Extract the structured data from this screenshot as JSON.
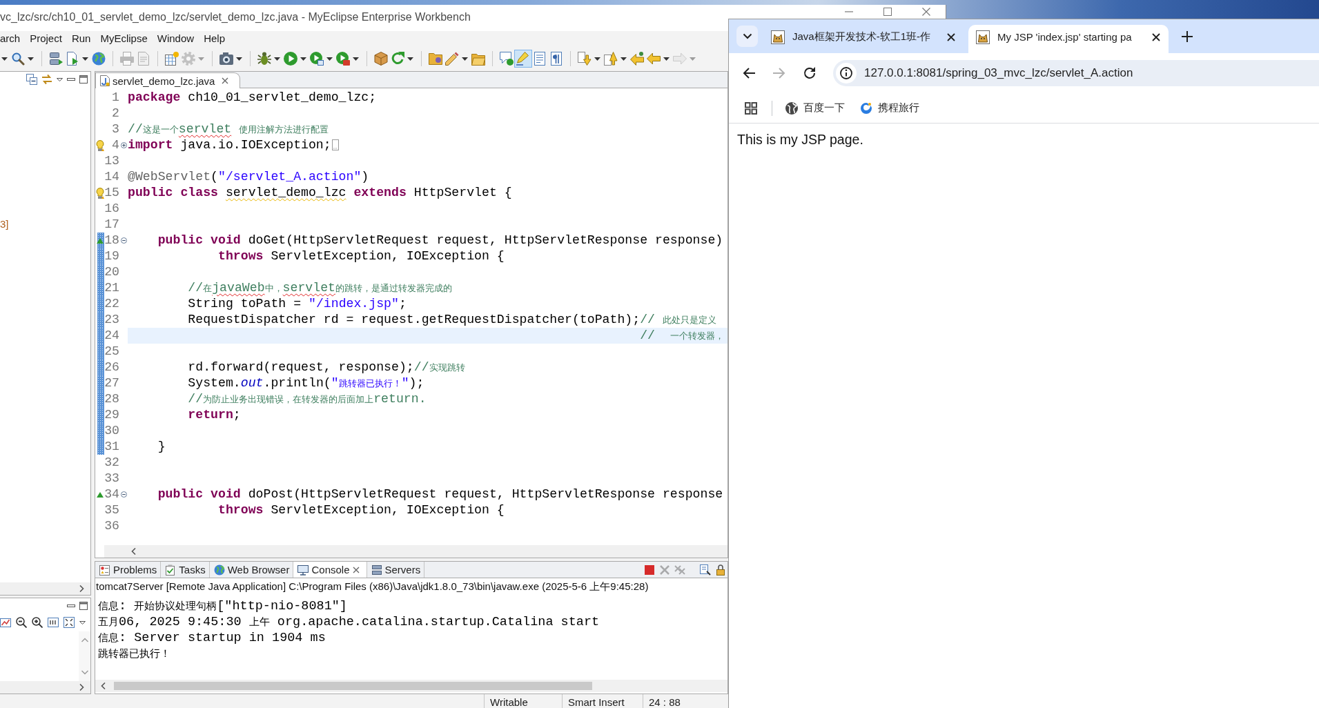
{
  "ide": {
    "title": "vc_lzc/src/ch10_01_servlet_demo_lzc/servlet_demo_lzc.java - MyEclipse Enterprise Workbench",
    "menu": [
      "arch",
      "Project",
      "Run",
      "MyEclipse",
      "Window",
      "Help"
    ],
    "toolbar": [
      [
        {
          "disabled": false,
          "on": false
        }
      ],
      [
        {
          "disabled": false,
          "on": false
        },
        {
          "disabled": false,
          "on": false
        },
        {
          "disabled": false,
          "on": false
        }
      ],
      [
        {
          "disabled": true,
          "on": false
        },
        {
          "disabled": true,
          "on": false
        }
      ],
      [
        {
          "disabled": false,
          "on": false
        },
        {
          "disabled": true,
          "on": false
        }
      ],
      [
        {
          "disabled": false,
          "on": false
        }
      ],
      [
        {
          "disabled": false,
          "on": false
        },
        {
          "disabled": false,
          "on": false
        },
        {
          "disabled": false,
          "on": false
        },
        {
          "disabled": false,
          "on": false
        }
      ],
      [
        {
          "disabled": false,
          "on": false
        },
        {
          "disabled": false,
          "on": false
        }
      ],
      [
        {
          "disabled": false,
          "on": false
        },
        {
          "disabled": false,
          "on": false
        },
        {
          "disabled": false,
          "on": false
        }
      ],
      [
        {
          "disabled": false,
          "on": false
        },
        {
          "disabled": false,
          "on": true
        },
        {
          "disabled": false,
          "on": false
        },
        {
          "disabled": false,
          "on": false
        }
      ],
      [
        {
          "disabled": false,
          "on": false
        },
        {
          "disabled": false,
          "on": false
        },
        {
          "disabled": false,
          "on": false
        },
        {
          "disabled": false,
          "on": false
        },
        {
          "disabled": true,
          "on": false
        }
      ]
    ],
    "explorer": {
      "item_fragment": "3]"
    },
    "editor": {
      "tabs": [
        {
          "label": "servlet_demo_lzc.java",
          "selected": true
        }
      ],
      "lines": [
        {
          "number": "1",
          "range": false,
          "current": false,
          "tokens": [
            {
              "kind": "keyword",
              "text": "package"
            },
            {
              "kind": "plain",
              "text": " ch10_01_servlet_demo_lzc;"
            }
          ]
        },
        {
          "number": "2",
          "range": false,
          "current": false
        },
        {
          "number": "3",
          "range": false,
          "current": false,
          "tokens": [
            {
              "kind": "comment",
              "text": "//这是一个"
            },
            {
              "kind": "comment",
              "text": "servlet",
              "misspelled": true
            },
            {
              "kind": "comment",
              "text": " 使用注解方法进行配置"
            }
          ]
        },
        {
          "number": "4",
          "range": false,
          "current": false,
          "marker": {
            "kind": "warning"
          },
          "fold": {
            "collapsed": true
          },
          "tokens": [
            {
              "kind": "keyword",
              "text": "import"
            },
            {
              "kind": "plain",
              "text": " java.io.IOException;"
            }
          ]
        },
        {
          "number": "13",
          "range": false,
          "current": false
        },
        {
          "number": "14",
          "range": false,
          "current": false,
          "tokens": [
            {
              "kind": "annotation",
              "text": "@WebServlet"
            },
            {
              "kind": "plain",
              "text": "("
            },
            {
              "kind": "string",
              "text": "\"/servlet_A.action\""
            },
            {
              "kind": "plain",
              "text": ")"
            }
          ]
        },
        {
          "number": "15",
          "range": false,
          "current": false,
          "marker": {
            "kind": "warning"
          },
          "tokens": [
            {
              "kind": "keyword",
              "text": "public class "
            },
            {
              "kind": "plain",
              "text": "servlet_demo_lzc",
              "warning": true
            },
            {
              "kind": "keyword",
              "text": " extends"
            },
            {
              "kind": "plain",
              "text": " HttpServlet {"
            }
          ]
        },
        {
          "number": "16",
          "range": false,
          "current": false
        },
        {
          "number": "17",
          "range": false,
          "current": false
        },
        {
          "number": "18",
          "range": true,
          "current": false,
          "marker": {
            "kind": "override"
          },
          "fold": {
            "collapsed": false
          },
          "tokens": [
            {
              "kind": "keyword",
              "text": "\tpublic void"
            },
            {
              "kind": "plain",
              "text": " doGet(HttpServletRequest request, HttpServletResponse response)"
            }
          ]
        },
        {
          "number": "19",
          "range": true,
          "current": false,
          "tokens": [
            {
              "kind": "keyword",
              "text": "\t\t\tthrows"
            },
            {
              "kind": "plain",
              "text": " ServletException, IOException {"
            }
          ]
        },
        {
          "number": "20",
          "range": true,
          "current": false
        },
        {
          "number": "21",
          "range": true,
          "current": false,
          "tokens": [
            {
              "kind": "comment",
              "text": "\t\t//在"
            },
            {
              "kind": "comment",
              "text": "javaWeb",
              "misspelled": true
            },
            {
              "kind": "comment",
              "text": "中，"
            },
            {
              "kind": "comment",
              "text": "servlet",
              "misspelled": true
            },
            {
              "kind": "comment",
              "text": "的跳转，是通过转发器完成的"
            }
          ]
        },
        {
          "number": "22",
          "range": true,
          "current": false,
          "tokens": [
            {
              "kind": "plain",
              "text": "\t\tString toPath = "
            },
            {
              "kind": "string",
              "text": "\"/index.jsp\""
            },
            {
              "kind": "plain",
              "text": ";"
            }
          ]
        },
        {
          "number": "23",
          "range": true,
          "current": false,
          "tokens": [
            {
              "kind": "plain",
              "text": "\t\tRequestDispatcher rd = request.getRequestDispatcher(toPath);"
            },
            {
              "kind": "comment",
              "text": "// 此处只是定义"
            }
          ]
        },
        {
          "number": "24",
          "range": true,
          "current": true,
          "tokens": [
            {
              "kind": "comment",
              "text": "\t\t\t\t\t\t\t\t\t\t\t\t\t\t\t\t\t//  一个转发器，"
            }
          ]
        },
        {
          "number": "25",
          "range": true,
          "current": false
        },
        {
          "number": "26",
          "range": true,
          "current": false,
          "tokens": [
            {
              "kind": "plain",
              "text": "\t\trd.forward(request, response);"
            },
            {
              "kind": "comment",
              "text": "//实现跳转"
            }
          ]
        },
        {
          "number": "27",
          "range": true,
          "current": false,
          "tokens": [
            {
              "kind": "plain",
              "text": "\t\tSystem."
            },
            {
              "kind": "field",
              "text": "out"
            },
            {
              "kind": "plain",
              "text": ".println("
            },
            {
              "kind": "string",
              "text": "\"跳转器已执行！\""
            },
            {
              "kind": "plain",
              "text": ");"
            }
          ]
        },
        {
          "number": "28",
          "range": true,
          "current": false,
          "tokens": [
            {
              "kind": "comment",
              "text": "\t\t//为防止业务出现错误，在转发器的后面加上return."
            }
          ]
        },
        {
          "number": "29",
          "range": true,
          "current": false,
          "tokens": [
            {
              "kind": "keyword",
              "text": "\t\treturn"
            },
            {
              "kind": "plain",
              "text": ";"
            }
          ]
        },
        {
          "number": "30",
          "range": true,
          "current": false
        },
        {
          "number": "31",
          "range": true,
          "current": false,
          "tokens": [
            {
              "kind": "plain",
              "text": "\t}"
            }
          ]
        },
        {
          "number": "32",
          "range": false,
          "current": false
        },
        {
          "number": "33",
          "range": false,
          "current": false
        },
        {
          "number": "34",
          "range": false,
          "current": false,
          "marker": {
            "kind": "override"
          },
          "fold": {
            "collapsed": false
          },
          "tokens": [
            {
              "kind": "keyword",
              "text": "\tpublic void"
            },
            {
              "kind": "plain",
              "text": " doPost(HttpServletRequest request, HttpServletResponse response"
            }
          ]
        },
        {
          "number": "35",
          "range": false,
          "current": false,
          "tokens": [
            {
              "kind": "keyword",
              "text": "\t\t\tthrows"
            },
            {
              "kind": "plain",
              "text": " ServletException, IOException {"
            }
          ]
        },
        {
          "number": "36",
          "range": false,
          "current": false
        }
      ]
    },
    "console": {
      "tabs": [
        {
          "label": "Problems",
          "selected": false
        },
        {
          "label": "Tasks",
          "selected": false
        },
        {
          "label": "Web Browser",
          "selected": false
        },
        {
          "label": "Console",
          "selected": true
        },
        {
          "label": "Servers",
          "selected": false
        }
      ],
      "actions": [
        {
          "disabled": false
        },
        {
          "disabled": true
        },
        {
          "disabled": true
        },
        {
          "disabled": false
        },
        {
          "disabled": false
        }
      ],
      "title": "tomcat7Server [Remote Java Application] C:\\Program Files (x86)\\Java\\jdk1.8.0_73\\bin\\javaw.exe (2025-5-6 上午9:45:28)",
      "lines": [
        "信息: 开始协议处理句柄[\"http-nio-8081\"]",
        "五月06, 2025 9:45:30 上午 org.apache.catalina.startup.Catalina start",
        "信息: Server startup in 1904 ms",
        "跳转器已执行！"
      ]
    },
    "status_bar": [
      "Writable",
      "Smart Insert",
      "24 : 88"
    ]
  },
  "browser": {
    "tabs": [
      {
        "title": "Java框架开发技术-软工1班-作",
        "selected": false
      },
      {
        "title": "My JSP 'index.jsp' starting pa",
        "selected": true
      }
    ],
    "nav": [
      {
        "disabled": false
      },
      {
        "disabled": true
      },
      {
        "disabled": false
      }
    ],
    "address": {
      "value": "127.0.0.1:8081/spring_03_mvc_lzc/servlet_A.action"
    },
    "bookmarks": [
      "百度一下",
      "携程旅行"
    ],
    "page_text": "This is my JSP page."
  }
}
